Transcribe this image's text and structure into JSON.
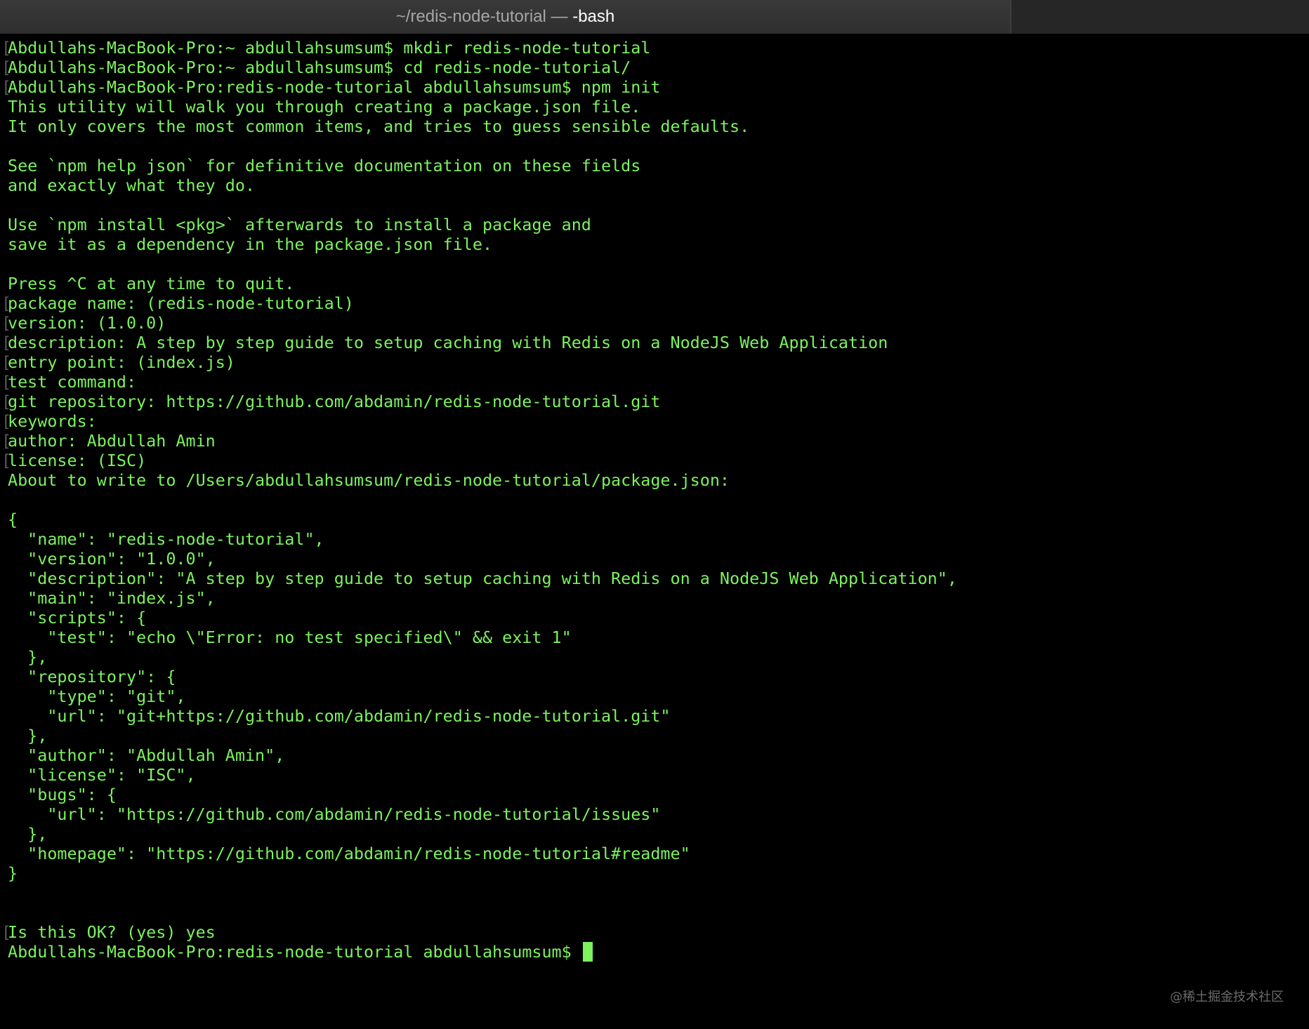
{
  "window": {
    "title_path": "~/redis-node-tutorial",
    "title_separator": " — ",
    "title_process": "-bash"
  },
  "terminal": {
    "lines": [
      {
        "mark": true,
        "text": "Abdullahs-MacBook-Pro:~ abdullahsumsum$ mkdir redis-node-tutorial"
      },
      {
        "mark": true,
        "text": "Abdullahs-MacBook-Pro:~ abdullahsumsum$ cd redis-node-tutorial/"
      },
      {
        "mark": true,
        "text": "Abdullahs-MacBook-Pro:redis-node-tutorial abdullahsumsum$ npm init"
      },
      {
        "mark": false,
        "text": "This utility will walk you through creating a package.json file."
      },
      {
        "mark": false,
        "text": "It only covers the most common items, and tries to guess sensible defaults."
      },
      {
        "mark": false,
        "text": ""
      },
      {
        "mark": false,
        "text": "See `npm help json` for definitive documentation on these fields"
      },
      {
        "mark": false,
        "text": "and exactly what they do."
      },
      {
        "mark": false,
        "text": ""
      },
      {
        "mark": false,
        "text": "Use `npm install <pkg>` afterwards to install a package and"
      },
      {
        "mark": false,
        "text": "save it as a dependency in the package.json file."
      },
      {
        "mark": false,
        "text": ""
      },
      {
        "mark": false,
        "text": "Press ^C at any time to quit."
      },
      {
        "mark": true,
        "text": "package name: (redis-node-tutorial)"
      },
      {
        "mark": true,
        "text": "version: (1.0.0)"
      },
      {
        "mark": true,
        "text": "description: A step by step guide to setup caching with Redis on a NodeJS Web Application"
      },
      {
        "mark": true,
        "text": "entry point: (index.js)"
      },
      {
        "mark": true,
        "text": "test command:"
      },
      {
        "mark": true,
        "text": "git repository: https://github.com/abdamin/redis-node-tutorial.git"
      },
      {
        "mark": true,
        "text": "keywords:"
      },
      {
        "mark": true,
        "text": "author: Abdullah Amin"
      },
      {
        "mark": true,
        "text": "license: (ISC)"
      },
      {
        "mark": false,
        "text": "About to write to /Users/abdullahsumsum/redis-node-tutorial/package.json:"
      },
      {
        "mark": false,
        "text": ""
      },
      {
        "mark": false,
        "text": "{"
      },
      {
        "mark": false,
        "text": "  \"name\": \"redis-node-tutorial\","
      },
      {
        "mark": false,
        "text": "  \"version\": \"1.0.0\","
      },
      {
        "mark": false,
        "text": "  \"description\": \"A step by step guide to setup caching with Redis on a NodeJS Web Application\","
      },
      {
        "mark": false,
        "text": "  \"main\": \"index.js\","
      },
      {
        "mark": false,
        "text": "  \"scripts\": {"
      },
      {
        "mark": false,
        "text": "    \"test\": \"echo \\\"Error: no test specified\\\" && exit 1\""
      },
      {
        "mark": false,
        "text": "  },"
      },
      {
        "mark": false,
        "text": "  \"repository\": {"
      },
      {
        "mark": false,
        "text": "    \"type\": \"git\","
      },
      {
        "mark": false,
        "text": "    \"url\": \"git+https://github.com/abdamin/redis-node-tutorial.git\""
      },
      {
        "mark": false,
        "text": "  },"
      },
      {
        "mark": false,
        "text": "  \"author\": \"Abdullah Amin\","
      },
      {
        "mark": false,
        "text": "  \"license\": \"ISC\","
      },
      {
        "mark": false,
        "text": "  \"bugs\": {"
      },
      {
        "mark": false,
        "text": "    \"url\": \"https://github.com/abdamin/redis-node-tutorial/issues\""
      },
      {
        "mark": false,
        "text": "  },"
      },
      {
        "mark": false,
        "text": "  \"homepage\": \"https://github.com/abdamin/redis-node-tutorial#readme\""
      },
      {
        "mark": false,
        "text": "}"
      },
      {
        "mark": false,
        "text": ""
      },
      {
        "mark": false,
        "text": ""
      },
      {
        "mark": true,
        "text": "Is this OK? (yes) yes"
      },
      {
        "mark": false,
        "text": "Abdullahs-MacBook-Pro:redis-node-tutorial abdullahsumsum$ ",
        "cursor": true
      }
    ]
  },
  "watermark": "@稀土掘金技术社区",
  "colors": {
    "text": "#7cf25e",
    "background": "#000000",
    "titlebar": "#2b2b2b"
  }
}
